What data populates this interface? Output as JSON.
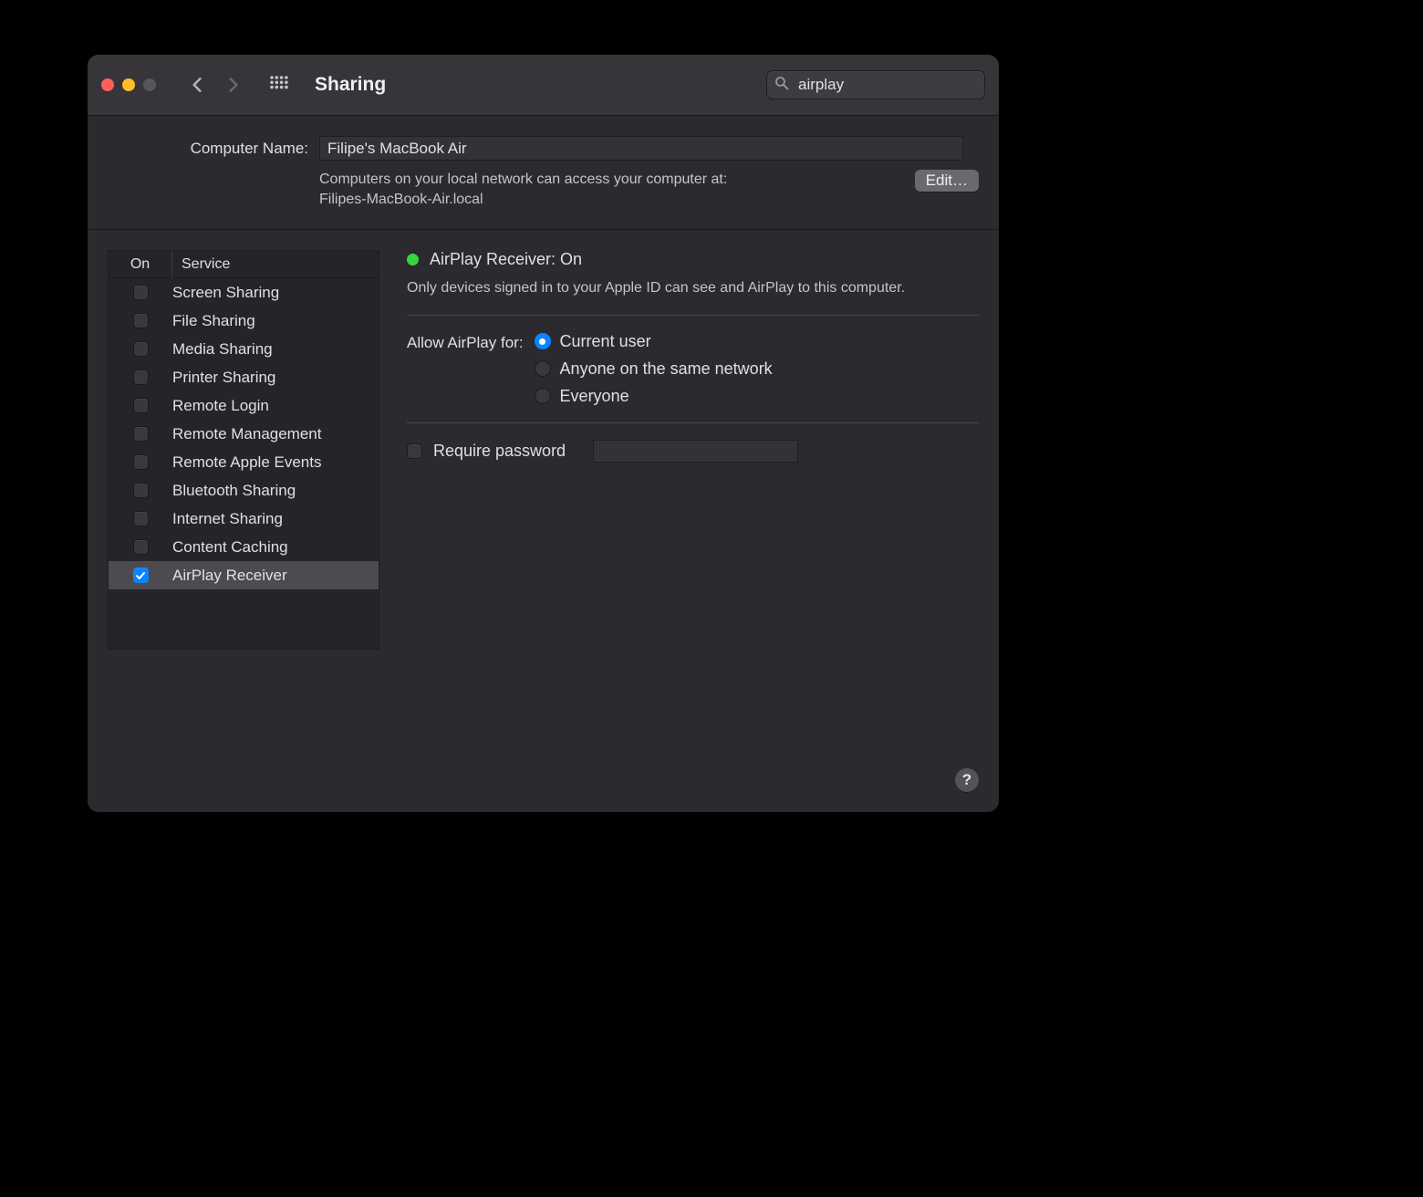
{
  "toolbar": {
    "title": "Sharing",
    "search_value": "airplay"
  },
  "computer": {
    "label": "Computer Name:",
    "name": "Filipe's MacBook Air",
    "info_line1": "Computers on your local network can access your computer at:",
    "info_line2": "Filipes-MacBook-Air.local",
    "edit_label": "Edit…"
  },
  "service_header_on": "On",
  "service_header_service": "Service",
  "services": [
    {
      "enabled": false,
      "name": "Screen Sharing",
      "selected": false
    },
    {
      "enabled": false,
      "name": "File Sharing",
      "selected": false
    },
    {
      "enabled": false,
      "name": "Media Sharing",
      "selected": false
    },
    {
      "enabled": false,
      "name": "Printer Sharing",
      "selected": false
    },
    {
      "enabled": false,
      "name": "Remote Login",
      "selected": false
    },
    {
      "enabled": false,
      "name": "Remote Management",
      "selected": false
    },
    {
      "enabled": false,
      "name": "Remote Apple Events",
      "selected": false
    },
    {
      "enabled": false,
      "name": "Bluetooth Sharing",
      "selected": false
    },
    {
      "enabled": false,
      "name": "Internet Sharing",
      "selected": false
    },
    {
      "enabled": false,
      "name": "Content Caching",
      "selected": false
    },
    {
      "enabled": true,
      "name": "AirPlay Receiver",
      "selected": true
    }
  ],
  "panel": {
    "status_title": "AirPlay Receiver: On",
    "status_color": "#35d63a",
    "description": "Only devices signed in to your Apple ID can see and AirPlay to this computer.",
    "allow_label": "Allow AirPlay for:",
    "options": [
      {
        "label": "Current user",
        "selected": true
      },
      {
        "label": "Anyone on the same network",
        "selected": false
      },
      {
        "label": "Everyone",
        "selected": false
      }
    ],
    "require_password_label": "Require password",
    "require_password_checked": false,
    "password_value": ""
  },
  "help": "?"
}
